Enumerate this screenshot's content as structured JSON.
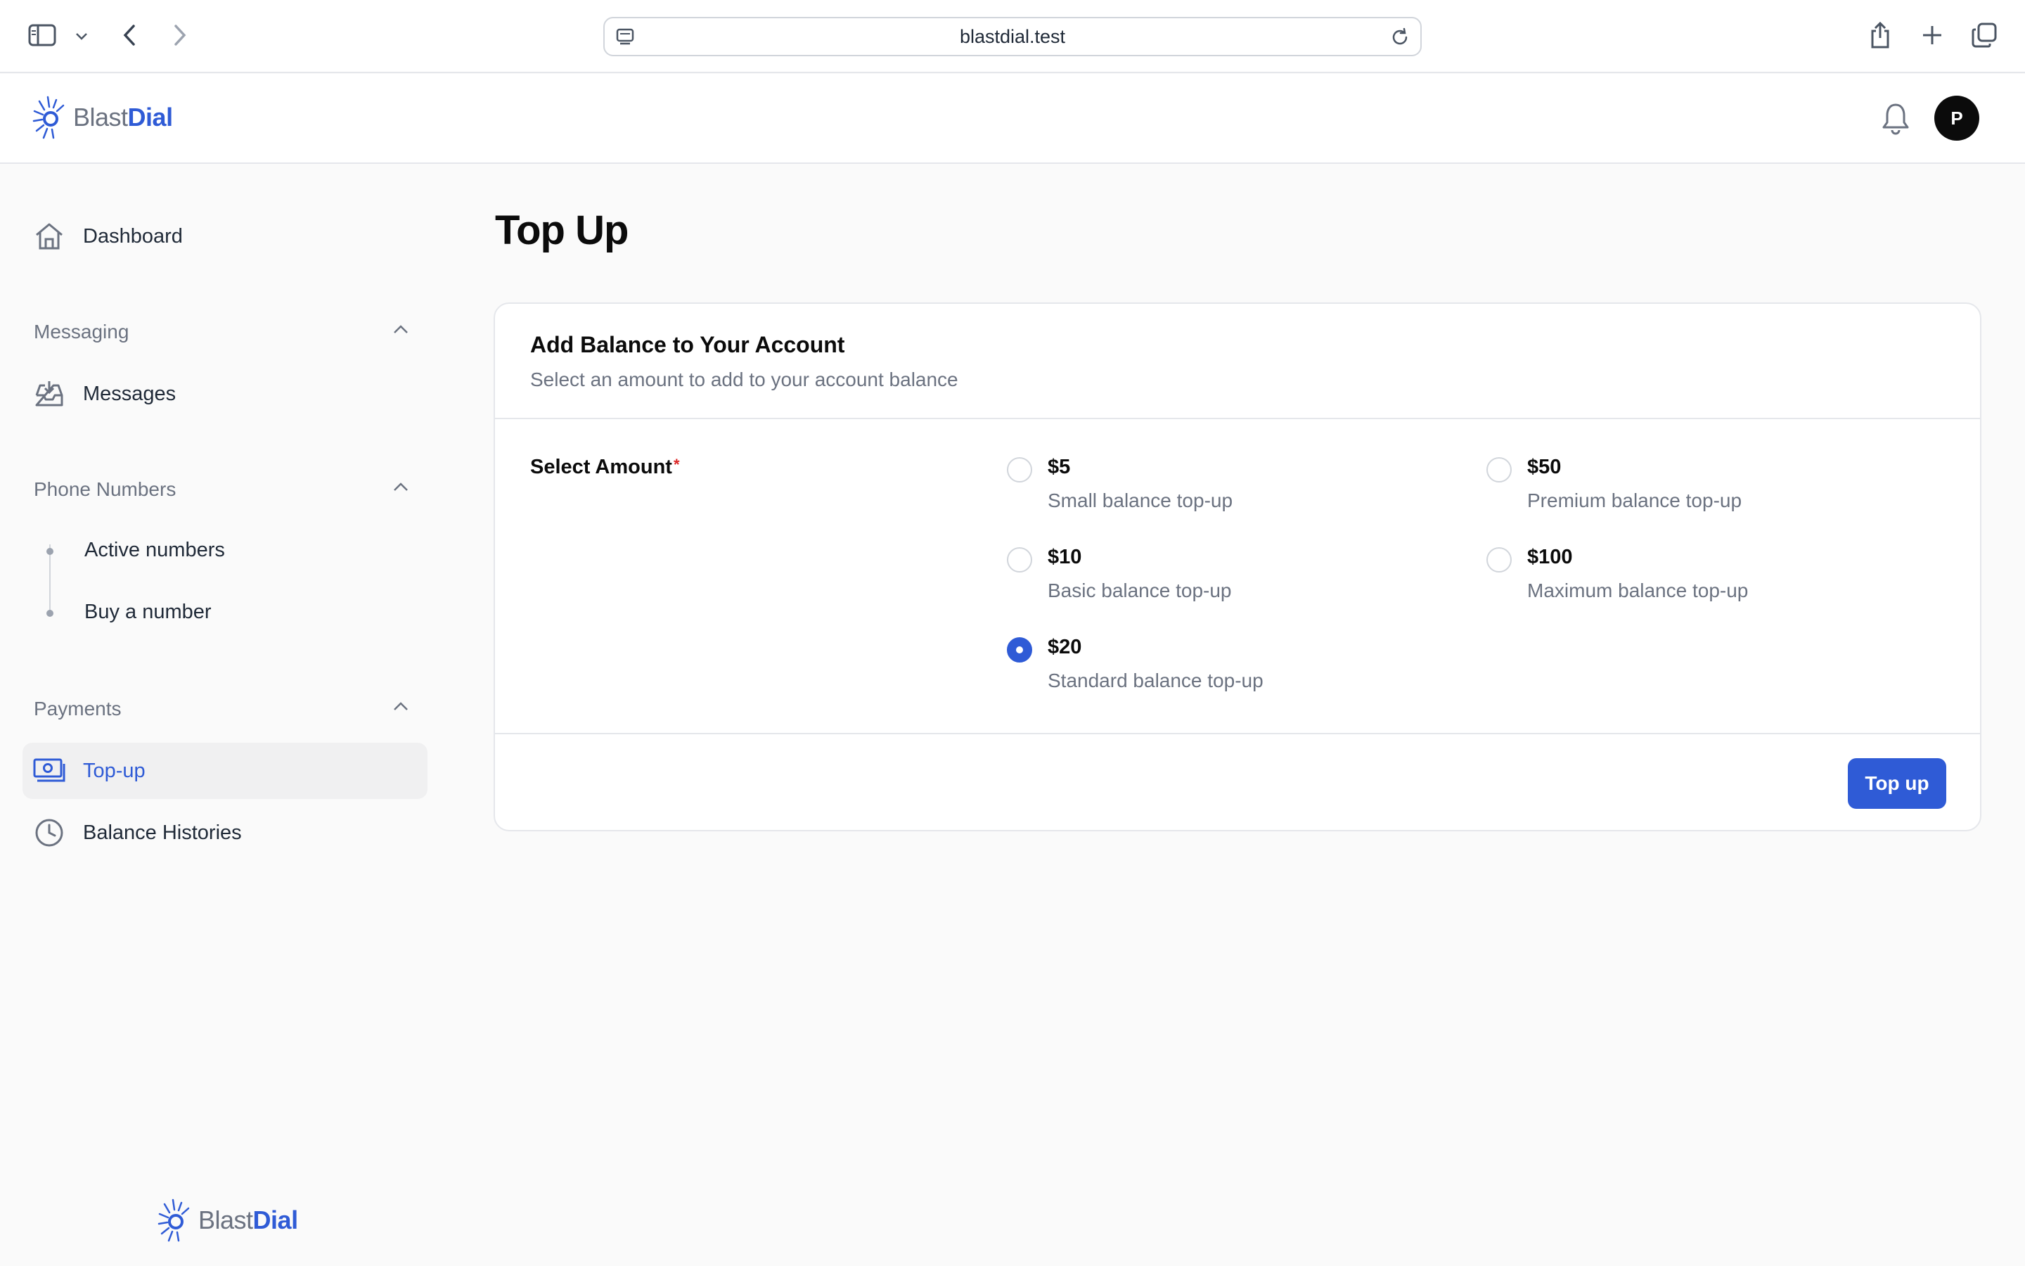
{
  "browser": {
    "url": "blastdial.test"
  },
  "brand": {
    "name_part1": "Blast",
    "name_part2": "Dial",
    "accent_color": "#2f5bd6"
  },
  "header": {
    "avatar_initial": "P"
  },
  "sidebar": {
    "dashboard": "Dashboard",
    "groups": [
      {
        "label": "Messaging",
        "items": [
          "Messages"
        ]
      },
      {
        "label": "Phone Numbers",
        "items": [
          "Active numbers",
          "Buy a number"
        ]
      },
      {
        "label": "Payments",
        "items": [
          "Top-up",
          "Balance Histories"
        ]
      }
    ],
    "active_item": "Top-up"
  },
  "page": {
    "title": "Top Up"
  },
  "card": {
    "title": "Add Balance to Your Account",
    "subtitle": "Select an amount to add to your account balance",
    "field_label": "Select Amount",
    "required_mark": "*",
    "options": [
      {
        "amount": "$5",
        "desc": "Small balance top-up",
        "checked": false
      },
      {
        "amount": "$10",
        "desc": "Basic balance top-up",
        "checked": false
      },
      {
        "amount": "$20",
        "desc": "Standard balance top-up",
        "checked": true
      },
      {
        "amount": "$50",
        "desc": "Premium balance top-up",
        "checked": false
      },
      {
        "amount": "$100",
        "desc": "Maximum balance top-up",
        "checked": false
      }
    ],
    "submit_label": "Top up"
  }
}
